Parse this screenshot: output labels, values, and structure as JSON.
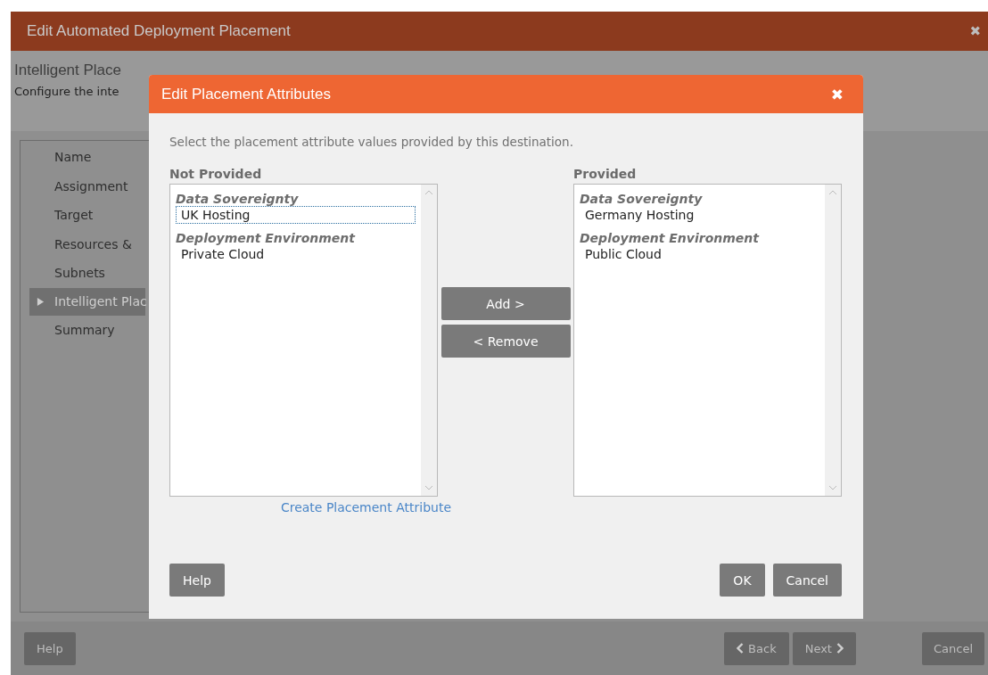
{
  "window": {
    "title": "Edit Automated Deployment Placement",
    "close": "✖"
  },
  "header": {
    "title": "Intelligent Place",
    "subtitle": "Configure the inte"
  },
  "sidebar": {
    "items": [
      {
        "label": "Name",
        "selected": false
      },
      {
        "label": "Assignment",
        "selected": false
      },
      {
        "label": "Target",
        "selected": false
      },
      {
        "label": "Resources &",
        "selected": false
      },
      {
        "label": "Subnets",
        "selected": false
      },
      {
        "label": "Intelligent Plac",
        "selected": true
      },
      {
        "label": "Summary",
        "selected": false
      }
    ]
  },
  "footer": {
    "help": "Help",
    "back": "Back",
    "next": "Next",
    "cancel": "Cancel"
  },
  "dialog": {
    "title": "Edit Placement Attributes",
    "close": "✖",
    "instruction": "Select the placement attribute values provided by this destination.",
    "not_provided": {
      "label": "Not Provided",
      "groups": [
        {
          "name": "Data Sovereignty",
          "items": [
            {
              "label": "UK Hosting",
              "selected": true
            }
          ]
        },
        {
          "name": "Deployment Environment",
          "items": [
            {
              "label": "Private Cloud",
              "selected": false
            }
          ]
        }
      ]
    },
    "provided": {
      "label": "Provided",
      "groups": [
        {
          "name": "Data Sovereignty",
          "items": [
            {
              "label": "Germany Hosting",
              "selected": false
            }
          ]
        },
        {
          "name": "Deployment Environment",
          "items": [
            {
              "label": "Public Cloud",
              "selected": false
            }
          ]
        }
      ]
    },
    "add": "Add >",
    "remove": "< Remove",
    "create_link": "Create Placement Attribute",
    "help": "Help",
    "ok": "OK",
    "cancel": "Cancel"
  }
}
